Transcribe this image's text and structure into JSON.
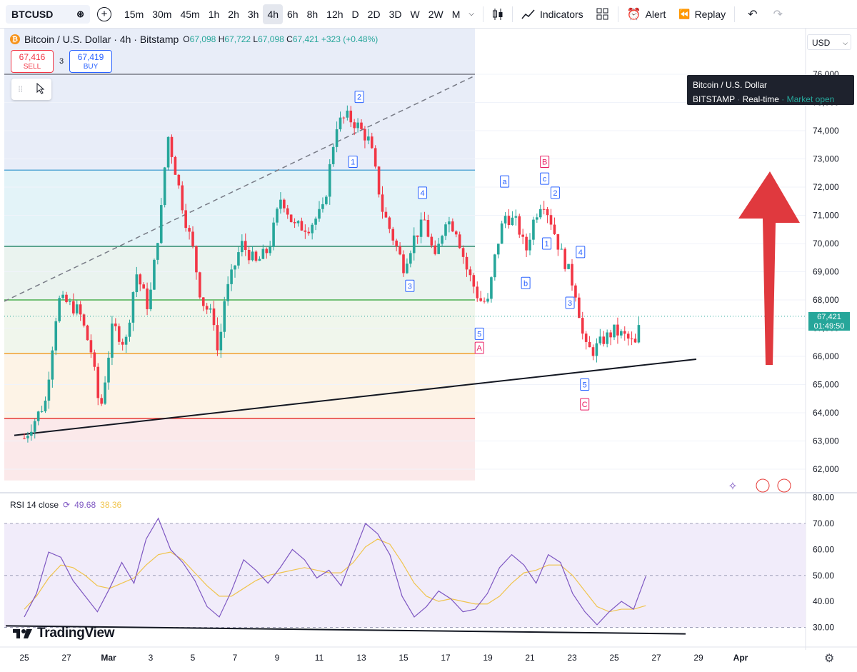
{
  "toolbar": {
    "symbol": "BTCUSD",
    "timeframes": [
      "15m",
      "30m",
      "45m",
      "1h",
      "2h",
      "3h",
      "4h",
      "6h",
      "8h",
      "12h",
      "D",
      "2D",
      "3D",
      "W",
      "2W",
      "M"
    ],
    "active_timeframe": "4h",
    "indicators_label": "Indicators",
    "alert_label": "Alert",
    "replay_label": "Replay"
  },
  "legend": {
    "title": "Bitcoin / U.S. Dollar · 4h · Bitstamp",
    "open_label": "O",
    "open": "67,098",
    "high_label": "H",
    "high": "67,722",
    "low_label": "L",
    "low": "67,098",
    "close_label": "C",
    "close": "67,421",
    "change": "+323 (+0.48%)"
  },
  "trade": {
    "sell_price": "67,416",
    "sell_label": "SELL",
    "spread": "3",
    "buy_price": "67,419",
    "buy_label": "BUY"
  },
  "tooltip": {
    "line1": "Bitcoin / U.S. Dollar",
    "exchange": "BITSTAMP",
    "mode": "Real-time",
    "status": "Market open"
  },
  "currency": "USD",
  "last_price": {
    "price": "67,421",
    "countdown": "01:49:50"
  },
  "rsi": {
    "label": "RSI 14 close",
    "value": "49.68",
    "ma_value": "38.36"
  },
  "brand": "TradingView",
  "colors": {
    "up": "#26a69a",
    "down": "#f23645",
    "rsi": "#7e57c2",
    "rsi_ma": "#f0c44d",
    "arrow": "#e0393e"
  },
  "chart_data": [
    {
      "type": "candlestick",
      "title": "Bitcoin / U.S. Dollar · 4h · Bitstamp",
      "x_tick_labels": [
        "25",
        "27",
        "Mar",
        "3",
        "5",
        "7",
        "9",
        "11",
        "13",
        "15",
        "17",
        "19",
        "21",
        "23",
        "25",
        "27",
        "29",
        "Apr"
      ],
      "y_tick_labels": [
        "62,000",
        "63,000",
        "64,000",
        "65,000",
        "66,000",
        "67,000",
        "68,000",
        "69,000",
        "70,000",
        "71,000",
        "72,000",
        "73,000",
        "74,000",
        "75,000",
        "76,000"
      ],
      "ylim": [
        61600,
        76300
      ],
      "close_path": [
        {
          "x": 0.0,
          "close": 63100
        },
        {
          "x": 1.0,
          "close": 64400
        },
        {
          "x": 1.6,
          "close": 68000
        },
        {
          "x": 2.0,
          "close": 67900
        },
        {
          "x": 2.6,
          "close": 67600
        },
        {
          "x": 3.2,
          "close": 66100
        },
        {
          "x": 3.6,
          "close": 64000
        },
        {
          "x": 4.2,
          "close": 67100
        },
        {
          "x": 4.8,
          "close": 66400
        },
        {
          "x": 5.3,
          "close": 69000
        },
        {
          "x": 5.9,
          "close": 67700
        },
        {
          "x": 6.5,
          "close": 71200
        },
        {
          "x": 6.8,
          "close": 73900
        },
        {
          "x": 7.2,
          "close": 72500
        },
        {
          "x": 7.6,
          "close": 71000
        },
        {
          "x": 8.0,
          "close": 69800
        },
        {
          "x": 8.4,
          "close": 68000
        },
        {
          "x": 9.0,
          "close": 67300
        },
        {
          "x": 9.2,
          "close": 66000
        },
        {
          "x": 9.5,
          "close": 68000
        },
        {
          "x": 10.3,
          "close": 70000
        },
        {
          "x": 11.0,
          "close": 69300
        },
        {
          "x": 11.6,
          "close": 69800
        },
        {
          "x": 12.2,
          "close": 71700
        },
        {
          "x": 12.8,
          "close": 70600
        },
        {
          "x": 13.5,
          "close": 70600
        },
        {
          "x": 14.2,
          "close": 71200
        },
        {
          "x": 14.8,
          "close": 74200
        },
        {
          "x": 15.3,
          "close": 74500
        },
        {
          "x": 15.8,
          "close": 74200
        },
        {
          "x": 16.4,
          "close": 73600
        },
        {
          "x": 17.0,
          "close": 71200
        },
        {
          "x": 17.6,
          "close": 70000
        },
        {
          "x": 18.0,
          "close": 69200
        },
        {
          "x": 18.5,
          "close": 70200
        },
        {
          "x": 19.0,
          "close": 70800
        },
        {
          "x": 19.5,
          "close": 69400
        },
        {
          "x": 20.0,
          "close": 70900
        },
        {
          "x": 20.5,
          "close": 70500
        },
        {
          "x": 21.0,
          "close": 69100
        },
        {
          "x": 21.6,
          "close": 68000
        },
        {
          "x": 22.0,
          "close": 67900
        },
        {
          "x": 22.4,
          "close": 69800
        },
        {
          "x": 22.8,
          "close": 71000
        },
        {
          "x": 23.4,
          "close": 70700
        },
        {
          "x": 23.8,
          "close": 69700
        },
        {
          "x": 24.2,
          "close": 70900
        },
        {
          "x": 24.6,
          "close": 71600
        },
        {
          "x": 25.0,
          "close": 70800
        },
        {
          "x": 25.4,
          "close": 69800
        },
        {
          "x": 25.8,
          "close": 69100
        },
        {
          "x": 26.2,
          "close": 68200
        },
        {
          "x": 26.6,
          "close": 66300
        },
        {
          "x": 27.0,
          "close": 66200
        },
        {
          "x": 27.5,
          "close": 66600
        },
        {
          "x": 28.0,
          "close": 66900
        },
        {
          "x": 28.5,
          "close": 66700
        },
        {
          "x": 29.0,
          "close": 66400
        },
        {
          "x": 29.3,
          "close": 67421
        }
      ],
      "horizontal_levels": [
        76000,
        72600,
        69900,
        68000,
        66100,
        63800
      ]
    },
    {
      "type": "line",
      "title": "RSI 14 close",
      "y_tick_labels": [
        "30.00",
        "40.00",
        "50.00",
        "60.00",
        "70.00",
        "80.00"
      ],
      "ylim": [
        25,
        82
      ],
      "series": [
        {
          "name": "RSI",
          "values": [
            34,
            43,
            59,
            57,
            48,
            42,
            36,
            45,
            55,
            47,
            64,
            72,
            60,
            55,
            48,
            38,
            34,
            44,
            56,
            52,
            47,
            53,
            60,
            56,
            49,
            52,
            46,
            58,
            70,
            66,
            58,
            42,
            34,
            38,
            44,
            41,
            36,
            37,
            43,
            53,
            58,
            54,
            47,
            58,
            55,
            43,
            36,
            31,
            36,
            40,
            37,
            49.68
          ]
        },
        {
          "name": "MA",
          "values": [
            37,
            42,
            49,
            54,
            53,
            50,
            46,
            45,
            47,
            49,
            54,
            58,
            59,
            56,
            51,
            46,
            42,
            42,
            45,
            48,
            50,
            51,
            52,
            53,
            52,
            51,
            51,
            55,
            61,
            64,
            62,
            55,
            47,
            42,
            40,
            41,
            40,
            39,
            39,
            42,
            47,
            51,
            52,
            54,
            54,
            50,
            44,
            38,
            36,
            37,
            37,
            38.36
          ]
        }
      ]
    }
  ],
  "wave_labels": [
    {
      "text": "2",
      "price": 75200,
      "xday": 15.9,
      "color": "#2962ff"
    },
    {
      "text": "1",
      "price": 72900,
      "xday": 15.6,
      "color": "#2962ff"
    },
    {
      "text": "4",
      "price": 71800,
      "xday": 18.9,
      "color": "#2962ff"
    },
    {
      "text": "3",
      "price": 68500,
      "xday": 18.3,
      "color": "#2962ff"
    },
    {
      "text": "a",
      "price": 72200,
      "xday": 22.8,
      "color": "#2962ff"
    },
    {
      "text": "B",
      "price": 72900,
      "xday": 24.7,
      "color": "#e91e63"
    },
    {
      "text": "c",
      "price": 72300,
      "xday": 24.7,
      "color": "#2962ff"
    },
    {
      "text": "2",
      "price": 71800,
      "xday": 25.2,
      "color": "#2962ff"
    },
    {
      "text": "1",
      "price": 70000,
      "xday": 24.8,
      "color": "#2962ff"
    },
    {
      "text": "b",
      "price": 68600,
      "xday": 23.8,
      "color": "#2962ff"
    },
    {
      "text": "4",
      "price": 69700,
      "xday": 26.4,
      "color": "#2962ff"
    },
    {
      "text": "3",
      "price": 67900,
      "xday": 25.9,
      "color": "#2962ff"
    },
    {
      "text": "5",
      "price": 66800,
      "xday": 21.6,
      "color": "#2962ff"
    },
    {
      "text": "A",
      "price": 66300,
      "xday": 21.6,
      "color": "#e91e63"
    },
    {
      "text": "5",
      "price": 65000,
      "xday": 26.6,
      "color": "#2962ff"
    },
    {
      "text": "C",
      "price": 64300,
      "xday": 26.6,
      "color": "#e91e63"
    }
  ]
}
